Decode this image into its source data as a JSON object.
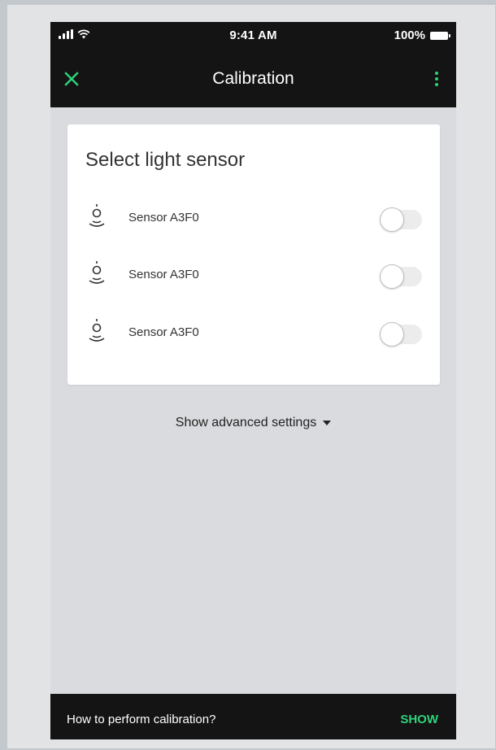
{
  "status_bar": {
    "time": "9:41 AM",
    "battery": "100%",
    "signal_icon": "cellular-signal-icon",
    "wifi_icon": "wifi-icon",
    "battery_icon": "battery-icon"
  },
  "app_bar": {
    "title": "Calibration",
    "close_icon": "close-icon",
    "menu_icon": "more-vertical-icon"
  },
  "card": {
    "title": "Select light sensor",
    "sensors": [
      {
        "label": "Sensor A3F0",
        "icon": "light-sensor-icon",
        "enabled": false
      },
      {
        "label": "Sensor A3F0",
        "icon": "light-sensor-icon",
        "enabled": false
      },
      {
        "label": "Sensor A3F0",
        "icon": "light-sensor-icon",
        "enabled": false
      }
    ]
  },
  "advanced": {
    "label": "Show advanced settings",
    "icon": "caret-down-icon"
  },
  "bottom_bar": {
    "text": "How to perform calibration?",
    "action": "SHOW"
  },
  "colors": {
    "accent": "#2fd27a",
    "bar_background": "#141414",
    "screen_background": "#dadbde",
    "card_background": "#ffffff",
    "page_background": "#c3c8cd"
  }
}
